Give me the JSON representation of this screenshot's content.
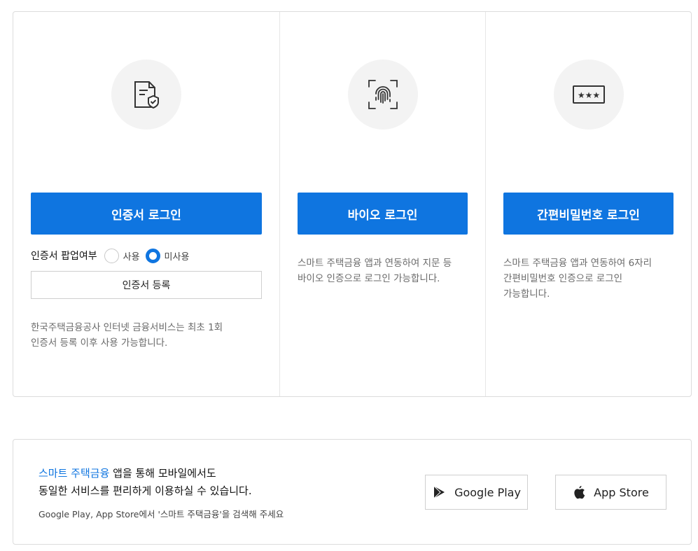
{
  "cert": {
    "button": "인증서 로그인",
    "popup_label": "인증서 팝업여부",
    "radio_use": "사용",
    "radio_nouse": "미사용",
    "register": "인증서 등록",
    "desc_line1": "한국주택금융공사 인터넷 금융서비스는 최초 1회",
    "desc_line2": "인증서 등록 이후 사용 가능합니다."
  },
  "bio": {
    "button": "바이오 로그인",
    "desc_line1": "스마트 주택금융 앱과 연동하여 지문 등",
    "desc_line2": "바이오 인증으로 로그인 가능합니다."
  },
  "pin": {
    "button": "간편비밀번호 로그인",
    "desc_line1": "스마트 주택금융 앱과 연동하여 6자리",
    "desc_line2": "간편비밀번호 인증으로 로그인",
    "desc_line3": "가능합니다."
  },
  "app": {
    "highlight": "스마트 주택금융",
    "line1_rest": " 앱을 통해 모바일에서도",
    "line2": "동일한 서비스를 편리하게 이용하실 수 있습니다.",
    "hint": "Google Play, App Store에서 '스마트 주택금융'을 검색해 주세요",
    "google_play": "Google Play",
    "app_store": "App Store"
  },
  "colors": {
    "primary": "#0f75e0",
    "icon_bg": "#f3f3f3"
  }
}
